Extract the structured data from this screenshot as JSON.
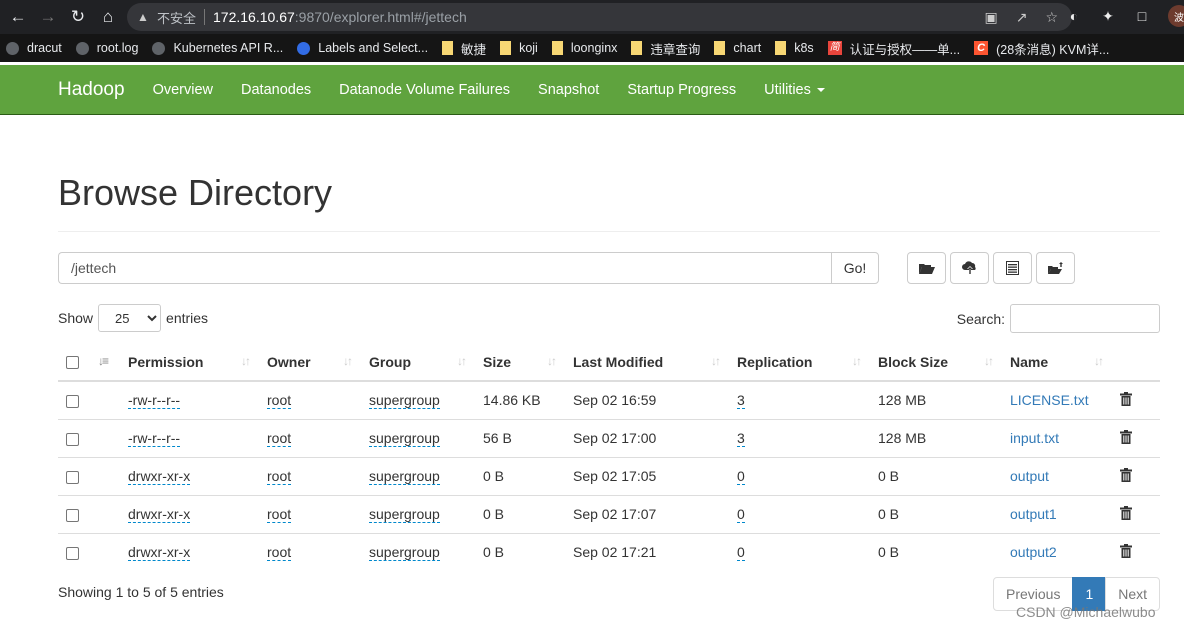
{
  "browser": {
    "insecure_label": "不安全",
    "url_host": "172.16.10.67",
    "url_rest": ":9870/explorer.html#/jettech",
    "bookmarks": [
      {
        "label": "dracut",
        "icon": "globe"
      },
      {
        "label": "root.log",
        "icon": "globe"
      },
      {
        "label": "Kubernetes API R...",
        "icon": "globe"
      },
      {
        "label": "Labels and Select...",
        "icon": "k8s"
      },
      {
        "label": "敏捷",
        "icon": "folder"
      },
      {
        "label": "koji",
        "icon": "folder"
      },
      {
        "label": "loonginx",
        "icon": "folder"
      },
      {
        "label": "违章查询",
        "icon": "folder"
      },
      {
        "label": "chart",
        "icon": "folder"
      },
      {
        "label": "k8s",
        "icon": "folder"
      },
      {
        "label": "认证与授权——单...",
        "icon": "jian"
      },
      {
        "label": "(28条消息) KVM详...",
        "icon": "csdn"
      }
    ],
    "avatar_label": "波"
  },
  "navbar": {
    "brand": "Hadoop",
    "links": [
      "Overview",
      "Datanodes",
      "Datanode Volume Failures",
      "Snapshot",
      "Startup Progress",
      "Utilities"
    ],
    "color": "#5fa33e"
  },
  "page": {
    "title": "Browse Directory",
    "path_value": "/jettech",
    "go_label": "Go!",
    "tools": [
      "create-directory",
      "upload-files",
      "cut-paste",
      "paste"
    ],
    "show_label": "Show",
    "entries_label": "entries",
    "page_length": "25",
    "search_label": "Search:",
    "search_value": ""
  },
  "table": {
    "headers": [
      "Permission",
      "Owner",
      "Group",
      "Size",
      "Last Modified",
      "Replication",
      "Block Size",
      "Name"
    ],
    "rows": [
      {
        "permission": "-rw-r--r--",
        "owner": "root",
        "group": "supergroup",
        "size": "14.86 KB",
        "modified": "Sep 02 16:59",
        "replication": "3",
        "block_size": "128 MB",
        "name": "LICENSE.txt"
      },
      {
        "permission": "-rw-r--r--",
        "owner": "root",
        "group": "supergroup",
        "size": "56 B",
        "modified": "Sep 02 17:00",
        "replication": "3",
        "block_size": "128 MB",
        "name": "input.txt"
      },
      {
        "permission": "drwxr-xr-x",
        "owner": "root",
        "group": "supergroup",
        "size": "0 B",
        "modified": "Sep 02 17:05",
        "replication": "0",
        "block_size": "0 B",
        "name": "output"
      },
      {
        "permission": "drwxr-xr-x",
        "owner": "root",
        "group": "supergroup",
        "size": "0 B",
        "modified": "Sep 02 17:07",
        "replication": "0",
        "block_size": "0 B",
        "name": "output1"
      },
      {
        "permission": "drwxr-xr-x",
        "owner": "root",
        "group": "supergroup",
        "size": "0 B",
        "modified": "Sep 02 17:21",
        "replication": "0",
        "block_size": "0 B",
        "name": "output2"
      }
    ]
  },
  "footer": {
    "info": "Showing 1 to 5 of 5 entries",
    "previous": "Previous",
    "current_page": "1",
    "next": "Next",
    "watermark": "CSDN @Michaelwubo"
  }
}
